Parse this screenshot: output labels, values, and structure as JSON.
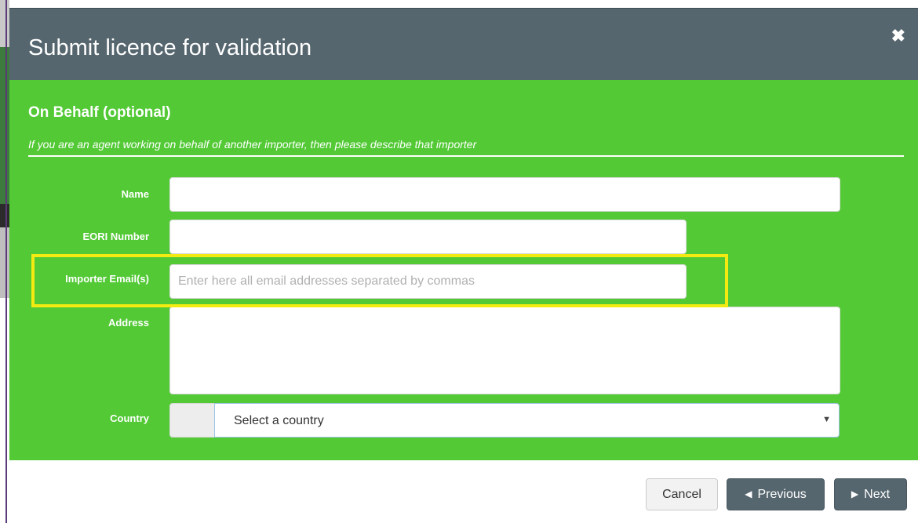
{
  "modal": {
    "title": "Submit licence for validation",
    "close_icon": "close-icon"
  },
  "section": {
    "title": "On Behalf (optional)",
    "description": "If you are an agent working on behalf of another importer, then please describe that importer"
  },
  "fields": {
    "name": {
      "label": "Name",
      "value": ""
    },
    "eori": {
      "label": "EORI Number",
      "value": ""
    },
    "email": {
      "label": "Importer Email(s)",
      "value": "",
      "placeholder": "Enter here all email addresses separated by commas"
    },
    "address": {
      "label": "Address",
      "value": ""
    },
    "country": {
      "label": "Country",
      "selected": "Select a country"
    }
  },
  "buttons": {
    "cancel": "Cancel",
    "previous": "Previous",
    "next": "Next"
  },
  "colors": {
    "header": "#56666f",
    "form_background": "#52c935",
    "highlight": "#f2ea10"
  }
}
